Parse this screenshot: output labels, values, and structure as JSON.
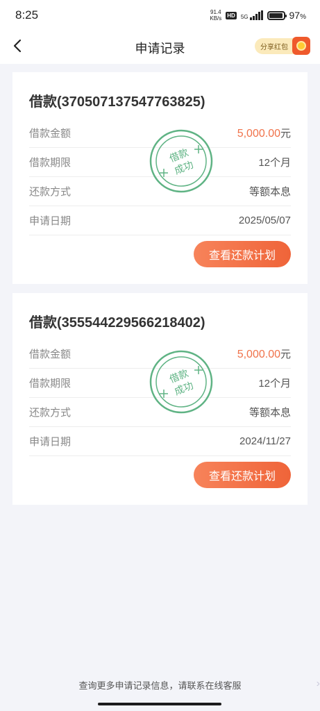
{
  "status_bar": {
    "time": "8:25",
    "net_speed_value": "91.4",
    "net_speed_unit": "KB/s",
    "hd_badge": "HD",
    "network_type": "5G",
    "battery_percent": "97",
    "battery_suffix": "%",
    "battery_level": 0.97
  },
  "nav": {
    "title": "申请记录",
    "share_label": "分享红包",
    "back_icon": "chevron-left-icon",
    "share_icon": "red-envelope-icon"
  },
  "records": [
    {
      "title": "借款(370507137547763825)",
      "stamp_text_line1": "借款",
      "stamp_text_line2": "成功",
      "fields": {
        "amount_label": "借款金额",
        "amount_value": "5,000.00",
        "amount_unit": "元",
        "term_label": "借款期限",
        "term_value": "12个月",
        "method_label": "还款方式",
        "method_value": "等额本息",
        "date_label": "申请日期",
        "date_value": "2025/05/07"
      },
      "plan_button": "查看还款计划"
    },
    {
      "title": "借款(355544229566218402)",
      "stamp_text_line1": "借款",
      "stamp_text_line2": "成功",
      "fields": {
        "amount_label": "借款金额",
        "amount_value": "5,000.00",
        "amount_unit": "元",
        "term_label": "借款期限",
        "term_value": "12个月",
        "method_label": "还款方式",
        "method_value": "等额本息",
        "date_label": "申请日期",
        "date_value": "2024/11/27"
      },
      "plan_button": "查看还款计划"
    }
  ],
  "footer": {
    "text": "查询更多申请记录信息，请联系在线客服",
    "arrow_icon": "chevron-right-icon"
  },
  "colors": {
    "accent_orange": "#ef6439",
    "amount_orange": "#f0724a",
    "stamp_green": "#5fb384",
    "page_background": "#f3f4f9"
  }
}
